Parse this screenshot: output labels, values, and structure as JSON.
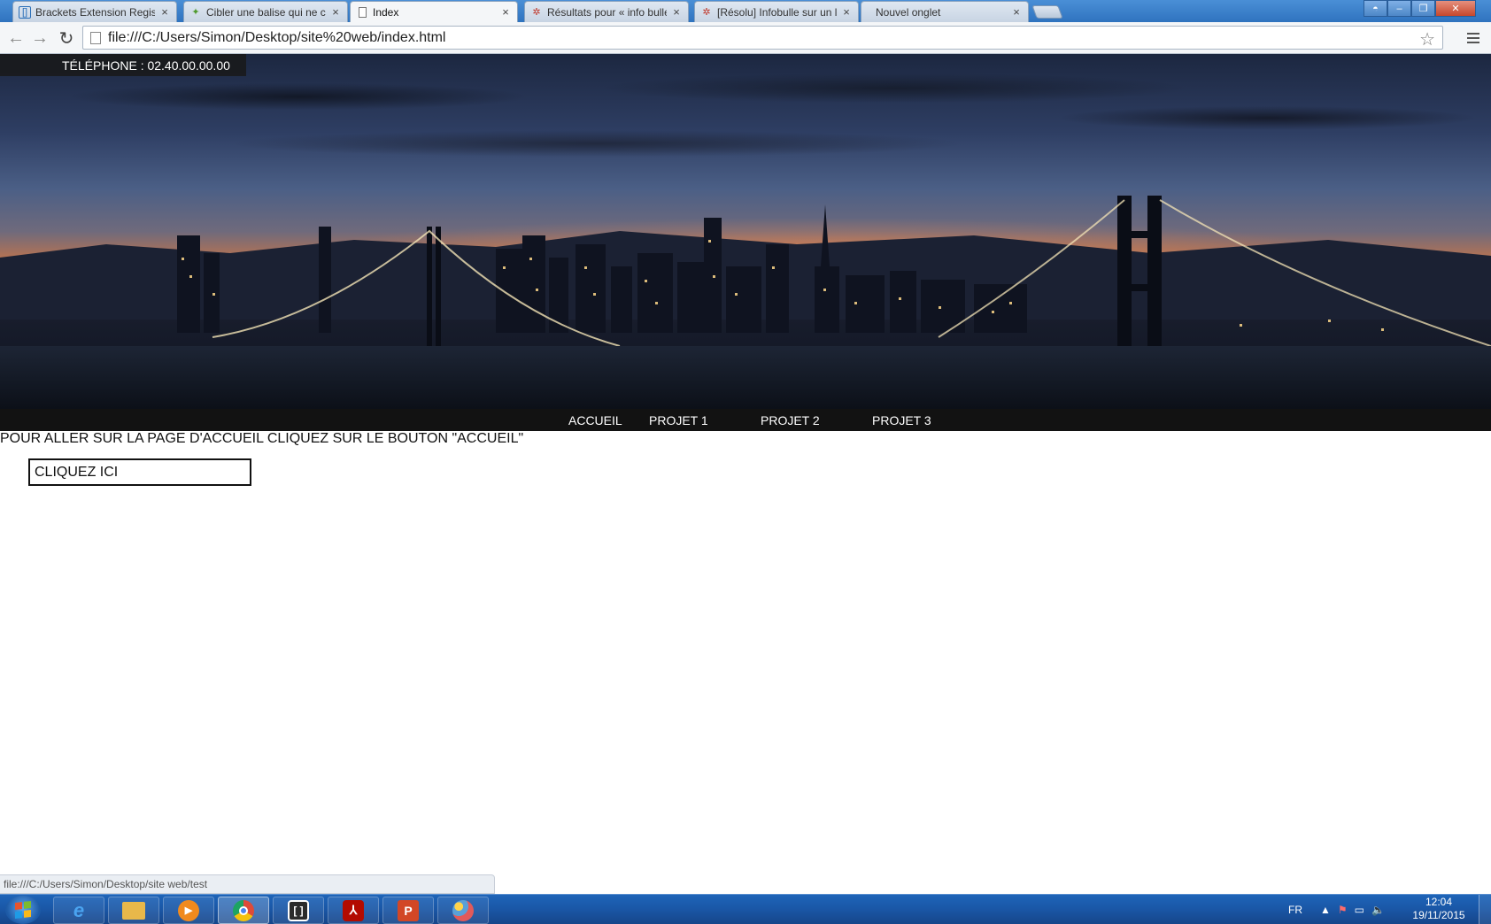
{
  "browser": {
    "tabs": [
      {
        "title": "Brackets Extension Regist",
        "favicon": "brackets-icon",
        "active": false
      },
      {
        "title": "Cibler une balise qui ne co",
        "favicon": "openclassrooms-icon",
        "active": false
      },
      {
        "title": "Index",
        "favicon": "page-icon",
        "active": true
      },
      {
        "title": "Résultats pour « info bulle",
        "favicon": "forum-icon",
        "active": false
      },
      {
        "title": "[Résolu] Infobulle sur un l",
        "favicon": "forum-icon",
        "active": false
      },
      {
        "title": "Nouvel onglet",
        "favicon": "",
        "active": false
      }
    ],
    "close_glyph": "×",
    "address": "file:///C:/Users/Simon/Desktop/site%20web/index.html",
    "status_url": "file:///C:/Users/Simon/Desktop/site web/test"
  },
  "site": {
    "phone": "TÉLÉPHONE : 02.40.00.00.00",
    "nav": [
      "ACCUEIL",
      "PROJET 1",
      "PROJET 2",
      "PROJET 3"
    ],
    "instruction": "POUR ALLER SUR LA PAGE D'ACCUEIL CLIQUEZ SUR LE BOUTON \"ACCUEIL\"",
    "cta": "CLIQUEZ ICI"
  },
  "taskbar": {
    "apps": [
      {
        "name": "internet-explorer",
        "color": "#2a8ae0"
      },
      {
        "name": "file-explorer",
        "color": "#e8b84a"
      },
      {
        "name": "media-player",
        "color": "#f08a1e"
      },
      {
        "name": "chrome",
        "color": "#dd4b39"
      },
      {
        "name": "brackets",
        "color": "#2b2b2b"
      },
      {
        "name": "acrobat-reader",
        "color": "#b30b00"
      },
      {
        "name": "powerpoint",
        "color": "#d24726"
      },
      {
        "name": "paint",
        "color": "#5aa0d8"
      }
    ],
    "language": "FR",
    "time": "12:04",
    "date": "19/11/2015"
  },
  "colors": {
    "nav_bar": "#121212",
    "taskbar": "#1a58a8"
  }
}
